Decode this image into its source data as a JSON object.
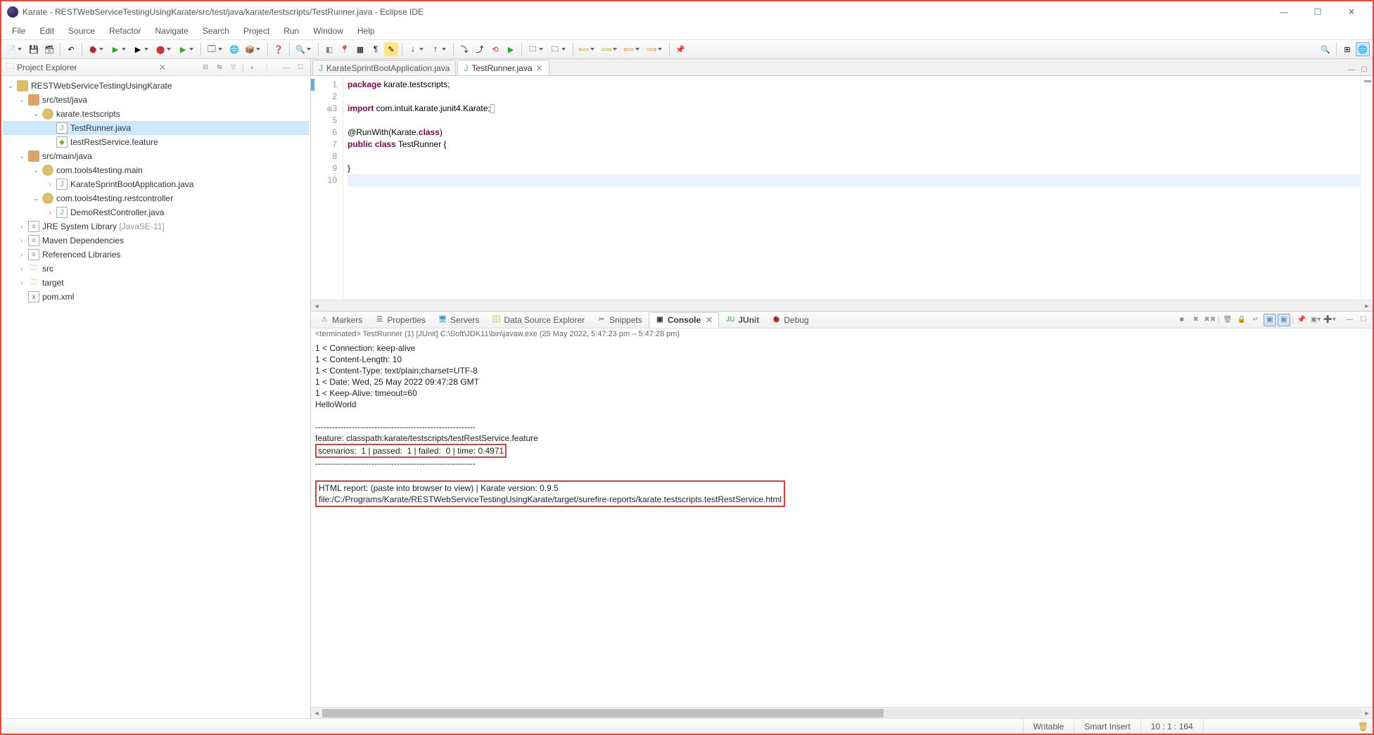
{
  "titlebar": {
    "text": "Karate - RESTWebServiceTestingUsingKarate/src/test/java/karate/testscripts/TestRunner.java - Eclipse IDE"
  },
  "menubar": [
    "File",
    "Edit",
    "Source",
    "Refactor",
    "Navigate",
    "Search",
    "Project",
    "Run",
    "Window",
    "Help"
  ],
  "sidebar": {
    "title": "Project Explorer",
    "tree": {
      "proj": "RESTWebServiceTestingUsingKarate",
      "srcTest": "src/test/java",
      "pkgTest": "karate.testscripts",
      "testRunner": "TestRunner.java",
      "feature": "testRestService.feature",
      "srcMain": "src/main/java",
      "pkgMain1": "com.tools4testing.main",
      "app": "KarateSprintBootApplication.java",
      "pkgMain2": "com.tools4testing.restcontroller",
      "ctrl": "DemoRestController.java",
      "jre": "JRE System Library ",
      "jreVer": "[JavaSE-11]",
      "maven": "Maven Dependencies",
      "reflib": "Referenced Libraries",
      "src": "src",
      "target": "target",
      "pom": "pom.xml"
    }
  },
  "editorTabs": {
    "tab1": "KarateSprintBootApplication.java",
    "tab2": "TestRunner.java"
  },
  "code": {
    "l1a": "package",
    "l1b": " karate.testscripts;",
    "l3a": "import",
    "l3b": " com.intuit.karate.junit4.Karate;",
    "l6a": "@RunWith(Karate.",
    "l6b": "class",
    "l6c": ")",
    "l7a": "public",
    "l7b": " ",
    "l7c": "class",
    "l7d": " TestRunner {",
    "l9": "}",
    "ln1": "1",
    "ln2": "2",
    "ln3": "3",
    "ln5": "5",
    "ln6": "6",
    "ln7": "7",
    "ln8": "8",
    "ln9": "9",
    "ln10": "10"
  },
  "bottomTabs": {
    "markers": "Markers",
    "properties": "Properties",
    "servers": "Servers",
    "dse": "Data Source Explorer",
    "snippets": "Snippets",
    "console": "Console",
    "junit": "JUnit",
    "debug": "Debug"
  },
  "terminfo": "<terminated> TestRunner (1) [JUnit] C:\\Soft\\JDK11\\bin\\javaw.exe  (25 May 2022, 5:47:23 pm – 5:47:28 pm)",
  "console": {
    "l1": "1 < Connection: keep-alive",
    "l2": "1 < Content-Length: 10",
    "l3": "1 < Content-Type: text/plain;charset=UTF-8",
    "l4": "1 < Date: Wed, 25 May 2022 09:47:28 GMT",
    "l5": "1 < Keep-Alive: timeout=60",
    "l6": "HelloWorld",
    "sep": "---------------------------------------------------------",
    "l8": "feature: classpath:karate/testscripts/testRestService.feature",
    "box1": "scenarios:  1 | passed:  1 | failed:  0 | time: 0.4971",
    "box2a": "HTML report: (paste into browser to view) | Karate version: 0.9.5",
    "box2b": "file:/C:/Programs/Karate/RESTWebServiceTestingUsingKarate/target/surefire-reports/karate.testscripts.testRestService.html"
  },
  "status": {
    "writable": "Writable",
    "insert": "Smart Insert",
    "pos": "10 : 1 : 164"
  }
}
